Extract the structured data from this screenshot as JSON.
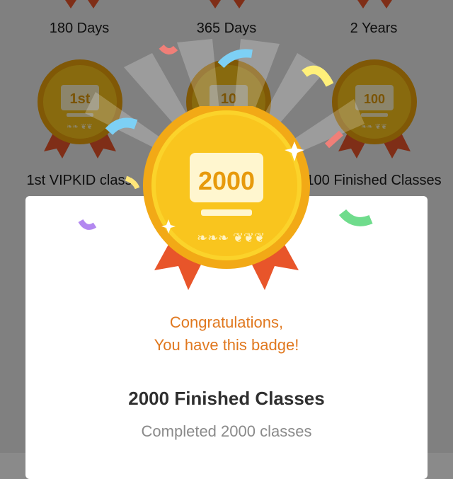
{
  "background_badges": {
    "top_row_labels": [
      "180 Days",
      "365 Days",
      "2 Years"
    ],
    "middle_row": [
      {
        "label": "1st VIPKID class",
        "emblem": "1st"
      },
      {
        "label": "",
        "emblem": "10"
      },
      {
        "label": "100 Finished Classes",
        "emblem": "100"
      }
    ]
  },
  "featured_badge": {
    "emblem": "2000",
    "congrats_line1": "Congratulations,",
    "congrats_line2": "You have this badge!",
    "title": "2000 Finished Classes",
    "subtitle": "Completed 2000 classes"
  },
  "colors": {
    "gold": "#f7c21b",
    "gold_dark": "#e9a10b",
    "ribbon": "#e8552a",
    "congrats_text": "#e0781f",
    "title_text": "#2f2f2f",
    "subtitle_text": "#8a8a8a"
  },
  "icons": [
    "sparkle-icon",
    "laurel-icon",
    "monitor-icon",
    "ribbon-icon",
    "confetti-icon"
  ]
}
